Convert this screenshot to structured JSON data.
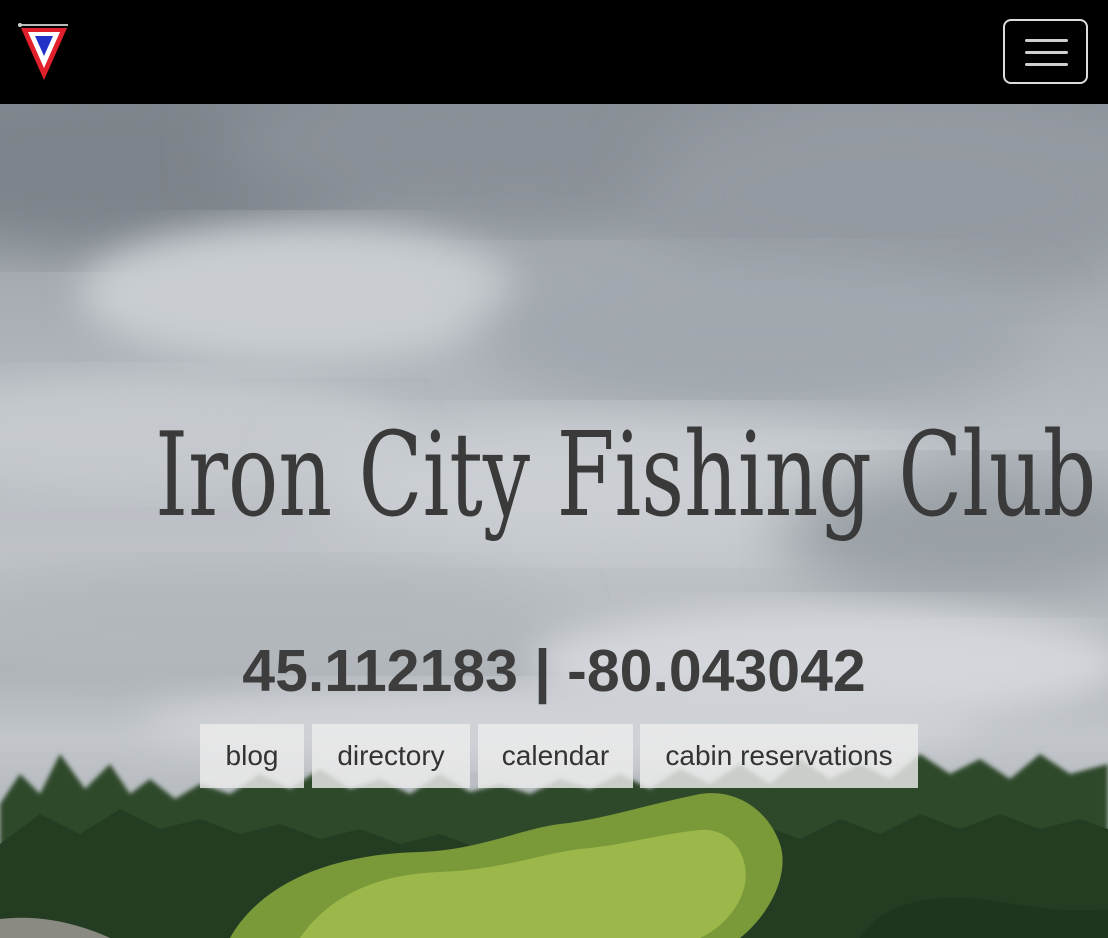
{
  "header": {
    "logo_icon": "burgee-flag-icon",
    "menu_icon": "hamburger-menu-icon",
    "logo_colors": {
      "red": "#e0202a",
      "white": "#ffffff",
      "blue": "#2232c8"
    }
  },
  "hero": {
    "title": "Iron City Fishing Club",
    "coordinates": "45.112183 | -80.043042",
    "links": [
      {
        "label": "blog"
      },
      {
        "label": "directory"
      },
      {
        "label": "calendar"
      },
      {
        "label": "cabin reservations"
      }
    ]
  },
  "colors": {
    "navbar_bg": "#000000",
    "title_text": "#3a3a3a",
    "link_bg": "#ececec"
  }
}
